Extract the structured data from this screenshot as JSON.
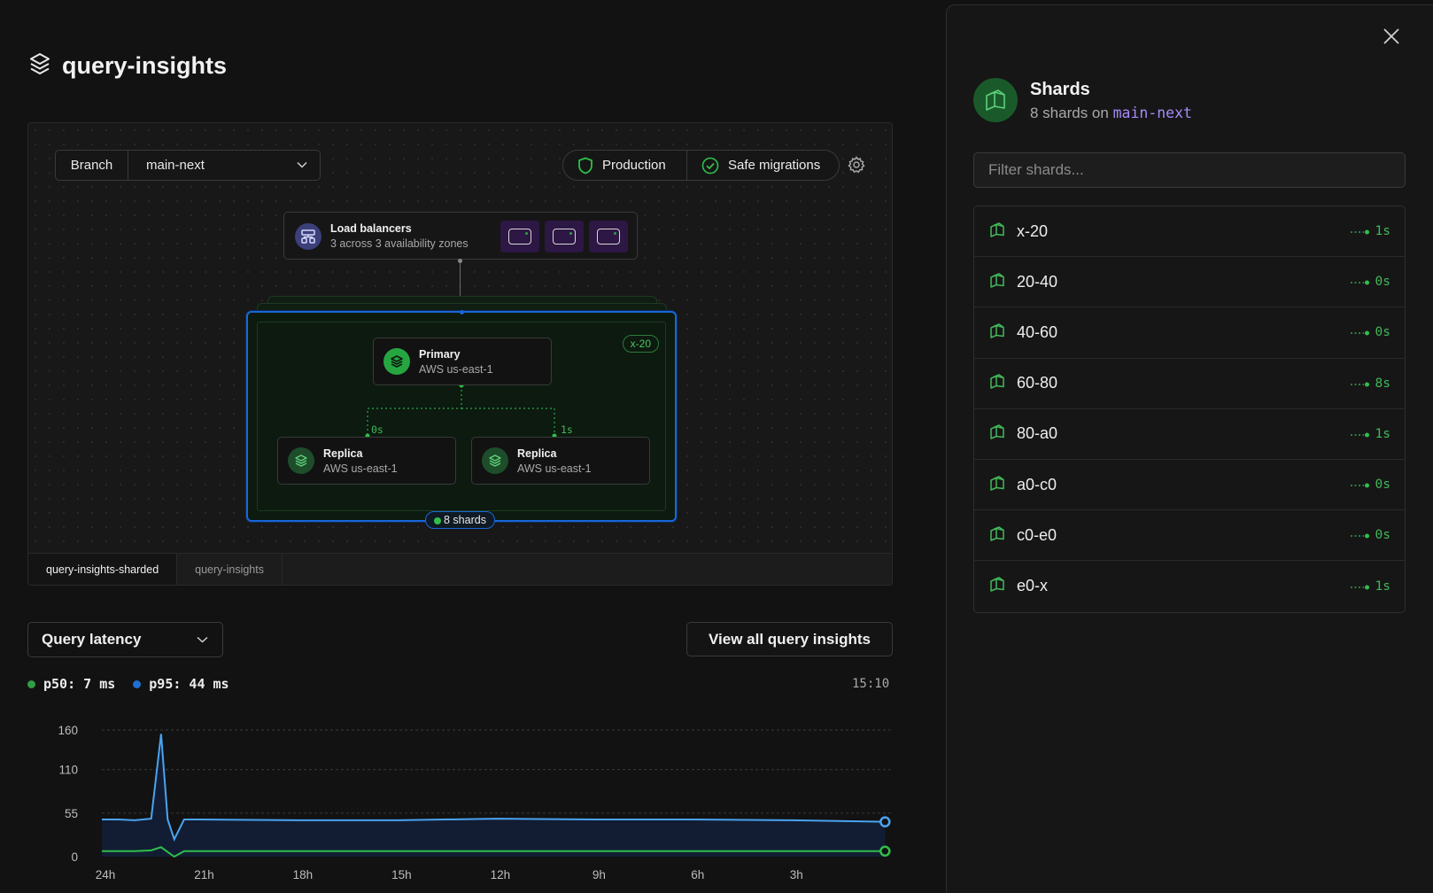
{
  "page": {
    "title": "query-insights"
  },
  "topology": {
    "branch_label": "Branch",
    "branch_value": "main-next",
    "env_production": "Production",
    "env_safe_migrations": "Safe migrations",
    "load_balancers": {
      "title": "Load balancers",
      "subtitle": "3 across 3 availability zones"
    },
    "shard_tag": "x-20",
    "primary": {
      "title": "Primary",
      "subtitle": "AWS us-east-1"
    },
    "replicas": [
      {
        "title": "Replica",
        "subtitle": "AWS us-east-1",
        "lag": "0s"
      },
      {
        "title": "Replica",
        "subtitle": "AWS us-east-1",
        "lag": "1s"
      }
    ],
    "shards_pill": "8 shards",
    "tabs": [
      "query-insights-sharded",
      "query-insights"
    ]
  },
  "latency": {
    "metric": "Query latency",
    "view_all": "View all query insights",
    "p50": "p50: 7 ms",
    "p95": "p95: 44 ms",
    "time_now": "15:10",
    "colors": {
      "p50": "#2fbf4a",
      "p95": "#4aa3f0"
    }
  },
  "chart_data": {
    "type": "line",
    "yticks": [
      0,
      55,
      110,
      160
    ],
    "ylim": [
      0,
      160
    ],
    "xticks": [
      "24h",
      "21h",
      "18h",
      "15h",
      "12h",
      "9h",
      "6h",
      "3h"
    ],
    "x": [
      24,
      23.5,
      23,
      22.5,
      22.2,
      22,
      21.8,
      21.5,
      21,
      18,
      15,
      12,
      9,
      6,
      3,
      0.2
    ],
    "series": [
      {
        "name": "p95",
        "values": [
          47,
          47,
          46,
          48,
          155,
          47,
          22,
          47,
          47,
          46,
          46,
          48,
          47,
          47,
          46,
          44
        ]
      },
      {
        "name": "p50",
        "values": [
          7,
          7,
          7,
          8,
          12,
          6,
          0,
          7,
          7,
          7,
          7,
          7,
          7,
          7,
          7,
          7
        ]
      }
    ]
  },
  "panel": {
    "title": "Shards",
    "subtitle_prefix": "8 shards on",
    "branch": "main-next",
    "filter_placeholder": "Filter shards...",
    "shards": [
      {
        "name": "x-20",
        "lag": "1s"
      },
      {
        "name": "20-40",
        "lag": "0s"
      },
      {
        "name": "40-60",
        "lag": "0s"
      },
      {
        "name": "60-80",
        "lag": "8s"
      },
      {
        "name": "80-a0",
        "lag": "1s"
      },
      {
        "name": "a0-c0",
        "lag": "0s"
      },
      {
        "name": "c0-e0",
        "lag": "0s"
      },
      {
        "name": "e0-x",
        "lag": "1s"
      }
    ]
  }
}
